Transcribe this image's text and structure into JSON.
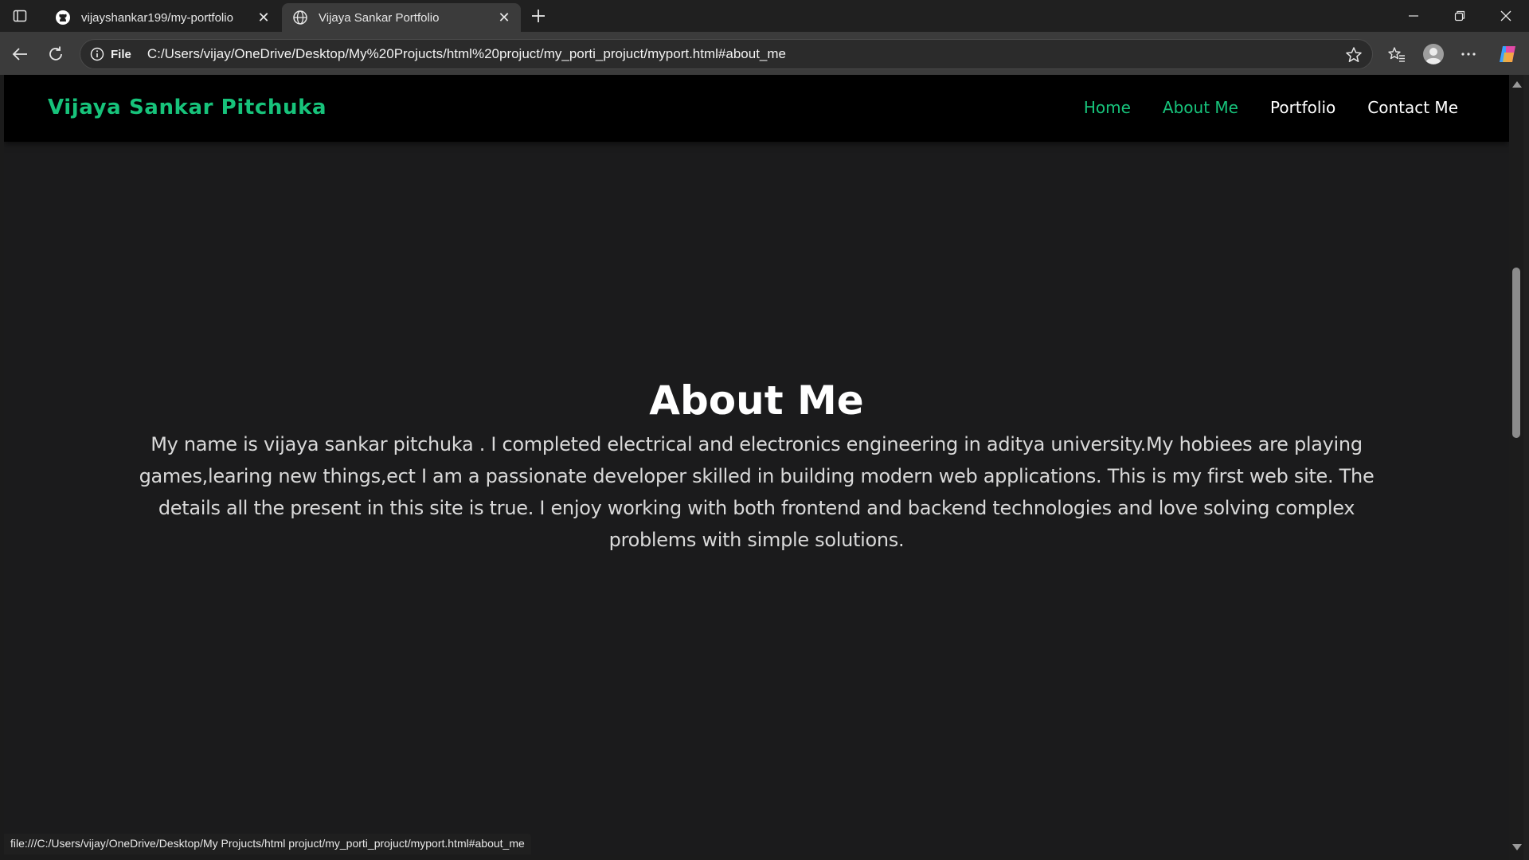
{
  "browser": {
    "tabs": [
      {
        "title": "vijayshankar199/my-portfolio",
        "favicon": "github-icon"
      },
      {
        "title": "Vijaya Sankar Portfolio",
        "favicon": "globe-icon"
      }
    ],
    "site_info_label": "File",
    "url": "C:/Users/vijay/OneDrive/Desktop/My%20Projucts/html%20projuct/my_porti_projuct/myport.html#about_me",
    "status_url": "file:///C:/Users/vijay/OneDrive/Desktop/My Projucts/html projuct/my_porti_projuct/myport.html#about_me"
  },
  "page": {
    "brand": "Vijaya Sankar Pitchuka",
    "nav": [
      {
        "label": "Home"
      },
      {
        "label": "About Me"
      },
      {
        "label": "Portfolio"
      },
      {
        "label": "Contact Me"
      }
    ],
    "about": {
      "heading": "About Me",
      "text": "My name is vijaya sankar pitchuka . I completed electrical and electronics engineering in aditya university.My hobiees are playing games,learing new things,ect I am a passionate developer skilled in building modern web applications. This is my first web site. The details all the present in this site is true. I enjoy working with both frontend and backend technologies and love solving complex problems with simple solutions."
    }
  },
  "colors": {
    "accent": "#17c37b",
    "page_bg": "#1b1b1c",
    "navbar_bg": "#000000"
  }
}
